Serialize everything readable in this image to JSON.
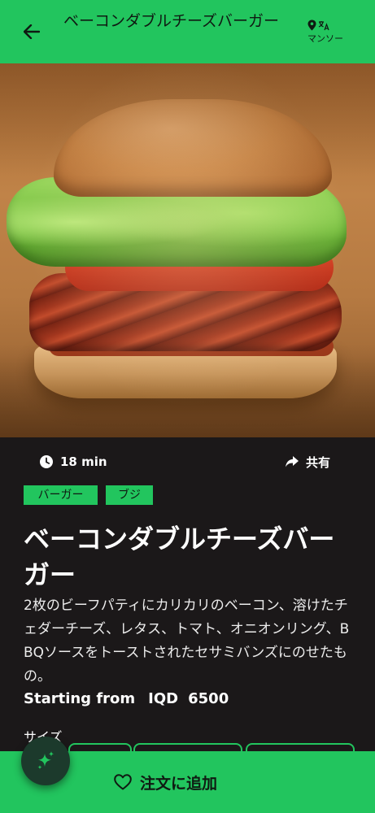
{
  "header": {
    "title": "ベーコンダブルチーズバーガー",
    "back_icon": "arrow-left-icon",
    "location_icon": "map-pin-icon",
    "translate_icon": "translate-icon",
    "location_label": "マンソー"
  },
  "hero": {
    "image": "bacon-double-cheeseburger-photo"
  },
  "meta": {
    "time_icon": "clock-icon",
    "time": "18 min",
    "share_icon": "share-icon",
    "share_label": "共有"
  },
  "tags": [
    "バーガー",
    "ブジ"
  ],
  "product": {
    "title": "ベーコンダブルチーズバーガー",
    "description": "2枚のビーフパティにカリカリのベーコン、溶けたチェダーチーズ、レタス、トマト、オニオンリング、BBQソースをトーストされたセサミバンズにのせたもの。",
    "price_label": "Starting from",
    "currency": "IQD",
    "price": "6500"
  },
  "size": {
    "label": "サイズ"
  },
  "actions": {
    "add_icon": "heart-icon",
    "add_label": "注文に追加",
    "fab_icon": "sparkles-icon"
  },
  "colors": {
    "accent": "#22c55e",
    "background": "#1b1819",
    "fab": "#1c3a2c"
  }
}
